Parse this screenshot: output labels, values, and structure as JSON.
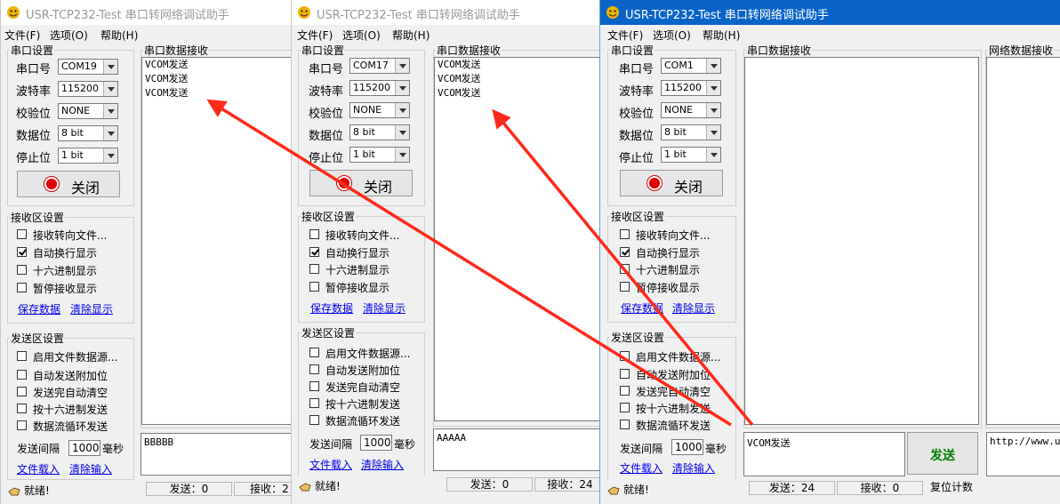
{
  "title": "USR-TCP232-Test 串口转网络调试助手",
  "menu": {
    "file": "文件(F)",
    "options": "选项(O)",
    "help": "帮助(H)"
  },
  "serial_settings": {
    "group_title": "串口设置",
    "port_label": "串口号",
    "baud_label": "波特率",
    "parity_label": "校验位",
    "databits_label": "数据位",
    "stopbits_label": "停止位",
    "baud": "115200",
    "parity": "NONE",
    "databits": "8 bit",
    "stopbits": "1 bit",
    "close_label": "关闭"
  },
  "rx_settings": {
    "group_title": "接收区设置",
    "options": [
      {
        "label": "接收转向文件...",
        "checked": false
      },
      {
        "label": "自动换行显示",
        "checked": true
      },
      {
        "label": "十六进制显示",
        "checked": false
      },
      {
        "label": "暂停接收显示",
        "checked": false
      }
    ],
    "save_link": "保存数据",
    "clear_link": "清除显示"
  },
  "tx_settings": {
    "group_title": "发送区设置",
    "options": [
      {
        "label": "启用文件数据源...",
        "checked": false
      },
      {
        "label": "自动发送附加位",
        "checked": false
      },
      {
        "label": "发送完自动清空",
        "checked": false
      },
      {
        "label": "按十六进制发送",
        "checked": false
      },
      {
        "label": "数据流循环发送",
        "checked": false
      }
    ],
    "interval_label": "发送间隔",
    "interval_value": "1000",
    "interval_unit": "毫秒",
    "load_link": "文件载入",
    "clear_link": "清除输入"
  },
  "serial_rx_title": "串口数据接收",
  "net_rx_title": "网络数据接收",
  "status": {
    "ready": "就绪!"
  },
  "windows": [
    {
      "port": "COM19",
      "rx_lines": [
        "VCOM发送",
        "VCOM发送",
        "VCOM发送"
      ],
      "tx_text": "BBBBB",
      "sent": "发送：0",
      "recv": "接收：2"
    },
    {
      "port": "COM17",
      "rx_lines": [
        "VCOM发送",
        "VCOM发送",
        "VCOM发送"
      ],
      "tx_text": "AAAAA",
      "sent": "发送：0",
      "recv": "接收：24"
    },
    {
      "port": "COM1",
      "rx_lines": [],
      "tx_text": "VCOM发送",
      "sent": "发送：24",
      "recv": "接收：0",
      "reset": "复位计数",
      "send_button": "发送",
      "net_tx_text": "http://www.usr"
    }
  ],
  "colors": {
    "arrow": "#ff2a1a",
    "active_title": "#0a64c8",
    "send_text": "#008000",
    "led": "#e00000",
    "link": "#0000ee"
  }
}
